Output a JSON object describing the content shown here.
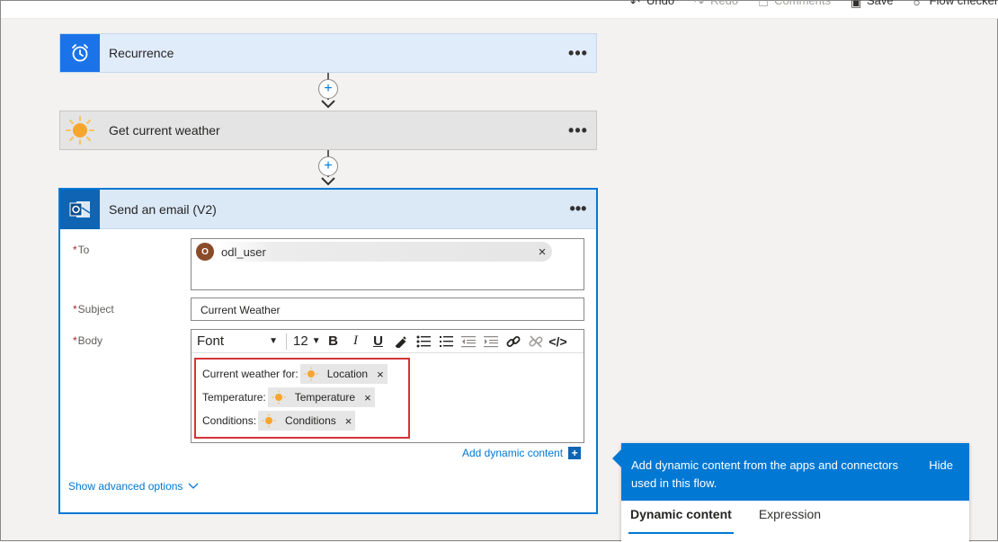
{
  "topbar": {
    "undo": "Undo",
    "redo": "Redo",
    "comments": "Comments",
    "save": "Save",
    "flow_checker": "Flow checker"
  },
  "steps": [
    {
      "title": "Recurrence",
      "icon": "alarm-clock-icon",
      "more": "•••"
    },
    {
      "title": "Get current weather",
      "icon": "sun-icon",
      "more": "•••"
    }
  ],
  "email": {
    "title": "Send an email (V2)",
    "more": "•••",
    "to_label": "To",
    "to_recipient": "odl_user",
    "to_avatar": "O",
    "subject_label": "Subject",
    "subject_value": "Current Weather",
    "body_label": "Body",
    "toolbar": {
      "font": "Font",
      "size": "12"
    },
    "body_lines": [
      {
        "text": "Current weather for:",
        "token": "Location"
      },
      {
        "text": "Temperature:",
        "token": "Temperature"
      },
      {
        "text": "Conditions:",
        "token": "Conditions"
      }
    ],
    "add_dynamic": "Add dynamic content",
    "show_advanced": "Show advanced options"
  },
  "panel": {
    "message": "Add dynamic content from the apps and connectors used in this flow.",
    "hide": "Hide",
    "tabs": [
      "Dynamic content",
      "Expression"
    ]
  },
  "colors": {
    "accent": "#0078d4",
    "highlight_border": "#d13438",
    "recurrence_icon_bg": "#1a73e8",
    "outlook_icon_bg": "#0f64b3"
  }
}
